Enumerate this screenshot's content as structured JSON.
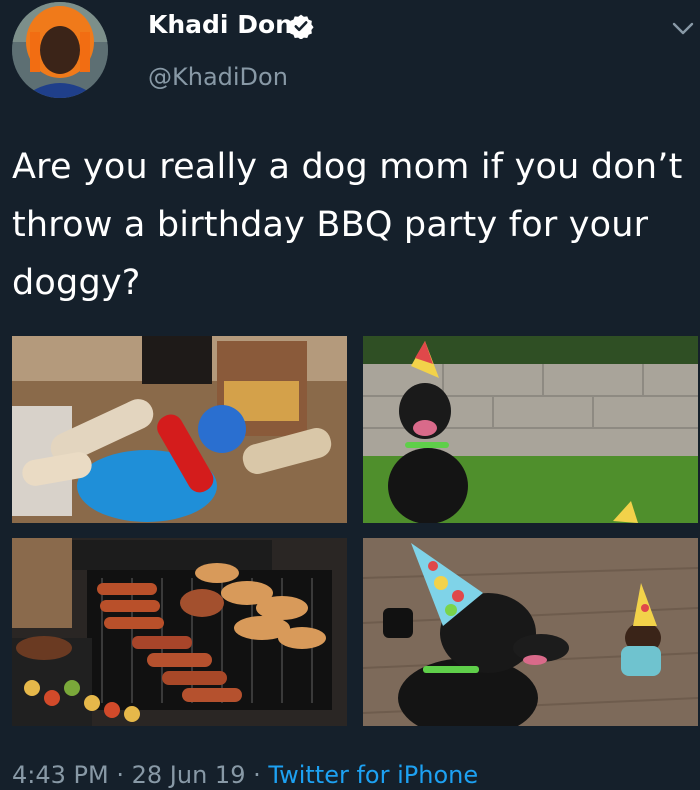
{
  "author": {
    "display_name": "Khadi Don",
    "handle": "@KhadiDon",
    "verified": true,
    "avatar_icon": "avatar-photo"
  },
  "tweet": {
    "text": "Are you really a dog mom if you don’t throw a birthday BBQ party for your doggy?",
    "photos": [
      {
        "subject": "dog toys and treats on a table"
      },
      {
        "subject": "black labrador in party hat on grass"
      },
      {
        "subject": "grill with sausages and chicken wings"
      },
      {
        "subject": "black labrador and small puppy in party hats"
      }
    ],
    "time": "4:43 PM",
    "separator": "·",
    "date": "28 Jun 19",
    "source": "Twitter for iPhone"
  },
  "colors": {
    "background": "#15202b",
    "text": "#ffffff",
    "secondary": "#8899a6",
    "link": "#1da1f2"
  }
}
